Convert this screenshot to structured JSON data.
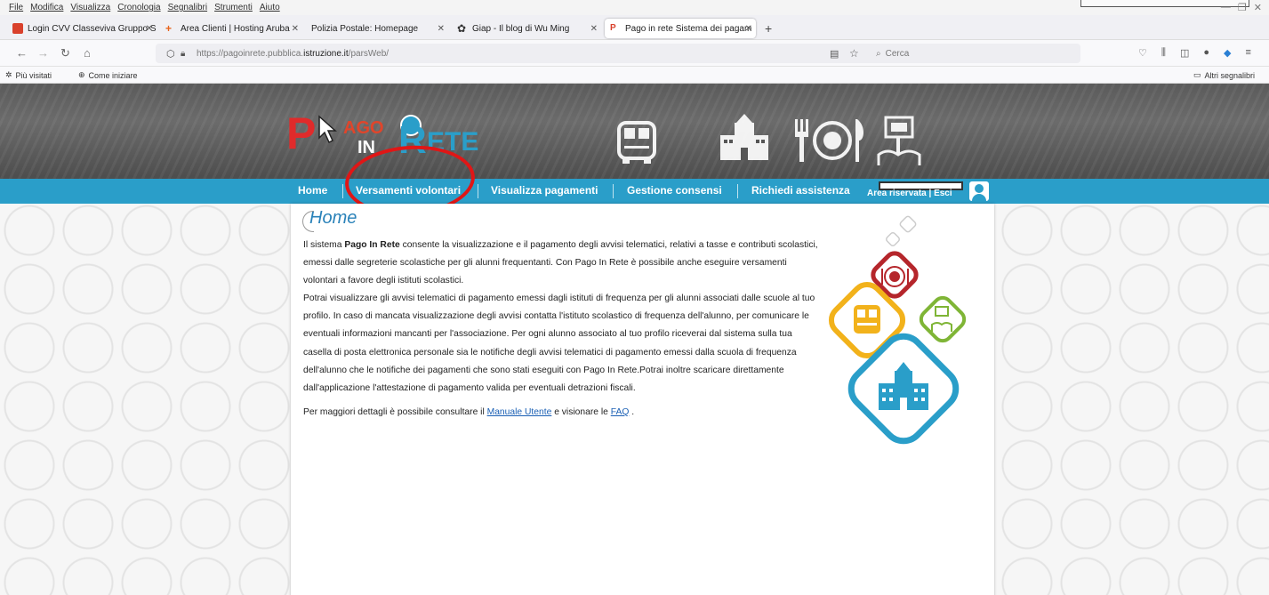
{
  "menubar": {
    "items": [
      "File",
      "Modifica",
      "Visualizza",
      "Cronologia",
      "Segnalibri",
      "Strumenti",
      "Aiuto"
    ]
  },
  "tabs": [
    {
      "label": "Login CVV Classeviva Gruppo S",
      "icon": "classeviva-favicon",
      "color": "#d9412c",
      "active": false
    },
    {
      "label": "Area Clienti | Hosting Aruba",
      "icon": "aruba-favicon",
      "color": "#e8641c",
      "active": false
    },
    {
      "label": "Polizia Postale: Homepage",
      "icon": "",
      "color": "",
      "active": false
    },
    {
      "label": "Giap - Il blog di Wu Ming",
      "icon": "giap-favicon",
      "color": "#333333",
      "active": false
    },
    {
      "label": "Pago in rete Sistema dei pagam",
      "icon": "pagoinrete-favicon",
      "color": "#d9412c",
      "active": true
    }
  ],
  "url": {
    "prefix": "https://pagoinrete.pubblica.",
    "domain": "istruzione.it",
    "path": "/parsWeb/",
    "search_placeholder": "Cerca"
  },
  "bookmarks": {
    "items": [
      "Più visitati",
      "Come iniziare"
    ],
    "other": "Altri segnalibri"
  },
  "site": {
    "logo": {
      "p": "P",
      "ago": "AGO",
      "in": "IN",
      "r": "R",
      "ete": "ETE"
    },
    "nav": [
      "Home",
      "Versamenti volontari",
      "Visualizza pagamenti",
      "Gestione consensi",
      "Richiedi assistenza"
    ],
    "area": "Area riservata | Esci",
    "accent": "#2a9ec9"
  },
  "main": {
    "title": "Home",
    "para1_a": "Il sistema ",
    "para1_b": "Pago In Rete",
    "para1_c": " consente la visualizzazione e il pagamento degli avvisi telematici, relativi a tasse e contributi scolastici, emessi dalle segreterie scolastiche per gli alunni frequentanti. Con Pago In Rete è possibile anche eseguire versamenti volontari a favore degli istituti scolastici.",
    "para2": "Potrai visualizzare gli avvisi telematici di pagamento emessi dagli istituti di frequenza per gli alunni associati dalle scuole al tuo profilo. In caso di mancata visualizzazione degli avvisi contatta l'istituto scolastico di frequenza dell'alunno, per comunicare le eventuali informazioni mancanti per l'associazione. Per ogni alunno associato al tuo profilo riceverai dal sistema sulla tua casella di posta elettronica personale sia le notifiche degli avvisi telematici di pagamento emessi dalla scuola di frequenza dell'alunno che le notifiche dei pagamenti che sono stati eseguiti con Pago In Rete.Potrai inoltre scaricare direttamente dall'applicazione l'attestazione di pagamento valida per eventuali detrazioni fiscali.",
    "para3_a": "Per maggiori dettagli è possibile consultare il ",
    "manual_link": "Manuale Utente",
    "para3_b": " e visionare le ",
    "faq_link": "FAQ",
    "para3_c": " ."
  }
}
